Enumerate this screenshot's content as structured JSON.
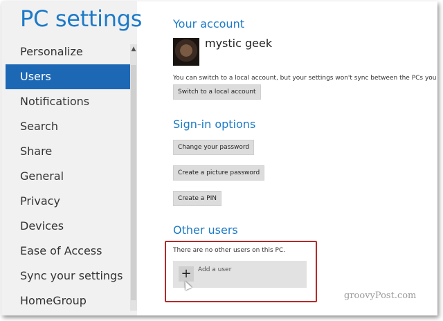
{
  "app": {
    "title": "PC settings"
  },
  "sidebar": {
    "items": [
      {
        "label": "Personalize",
        "selected": false
      },
      {
        "label": "Users",
        "selected": true
      },
      {
        "label": "Notifications",
        "selected": false
      },
      {
        "label": "Search",
        "selected": false
      },
      {
        "label": "Share",
        "selected": false
      },
      {
        "label": "General",
        "selected": false
      },
      {
        "label": "Privacy",
        "selected": false
      },
      {
        "label": "Devices",
        "selected": false
      },
      {
        "label": "Ease of Access",
        "selected": false
      },
      {
        "label": "Sync your settings",
        "selected": false
      },
      {
        "label": "HomeGroup",
        "selected": false
      }
    ],
    "scroll_up_icon": "▲"
  },
  "account": {
    "section_title": "Your account",
    "user_name": "mystic geek",
    "info_text": "You can switch to a local account, but your settings won't sync between the PCs you use.",
    "switch_button": "Switch to a local account"
  },
  "signin": {
    "section_title": "Sign-in options",
    "change_password_button": "Change your password",
    "picture_password_button": "Create a picture password",
    "pin_button": "Create a PIN"
  },
  "other_users": {
    "section_title": "Other users",
    "empty_text": "There are no other users on this PC.",
    "add_user_label": "Add a user",
    "add_icon": "+"
  },
  "watermark": "groovyPost.com",
  "colors": {
    "accent": "#1d7ac7",
    "selected_bg": "#1d68b5",
    "sidebar_bg": "#f1f1f2",
    "annotation_red": "#b42a2a"
  }
}
